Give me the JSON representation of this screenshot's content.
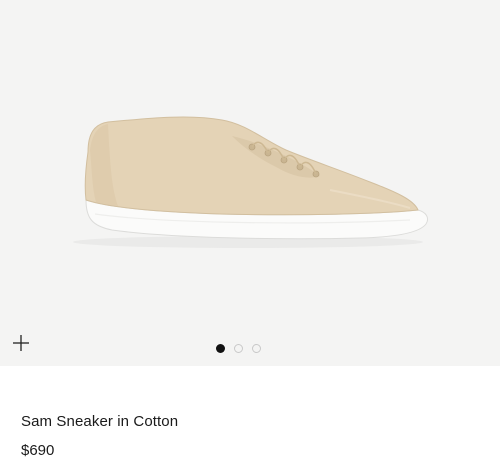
{
  "product": {
    "name": "Sam Sneaker in Cotton",
    "price": "$690",
    "image_subject": "beige cotton lace-up sneaker with white sole"
  },
  "actions": {
    "add_icon": "plus-icon"
  },
  "carousel": {
    "total_images": 3,
    "active_index": 0
  },
  "colors": {
    "image_background": "#f4f4f3",
    "shoe_upper": "#e4d3b6",
    "sole": "#ffffff",
    "text": "#1a1a1a"
  }
}
